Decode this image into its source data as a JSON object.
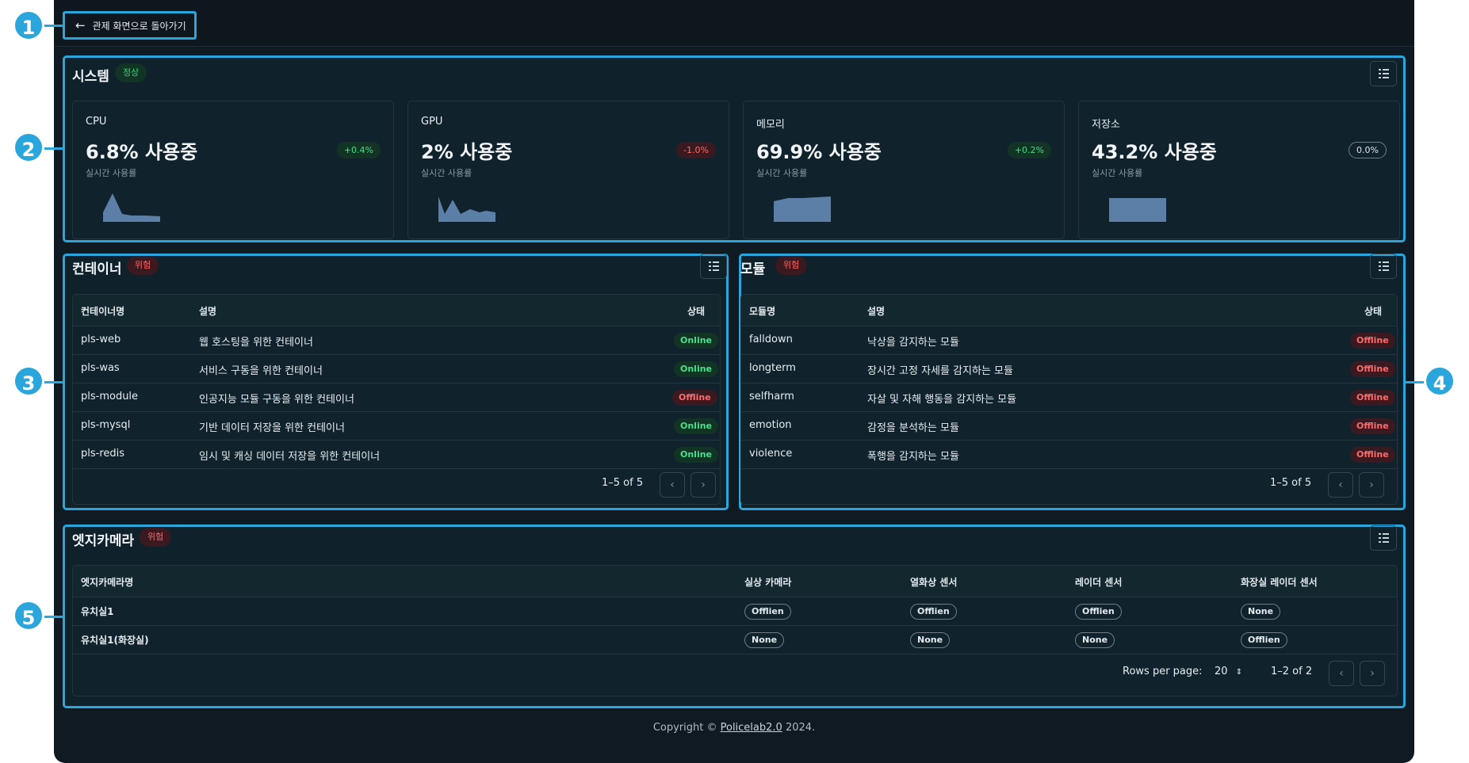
{
  "back_button": {
    "label": "관제 화면으로 돌아가기"
  },
  "system": {
    "title": "시스템",
    "status": "정상",
    "metrics": [
      {
        "name": "CPU",
        "value": "6.8% 사용중",
        "sub": "실시간 사용률",
        "delta": "+0.4%",
        "trend": "up"
      },
      {
        "name": "GPU",
        "value": "2% 사용중",
        "sub": "실시간 사용률",
        "delta": "-1.0%",
        "trend": "down"
      },
      {
        "name": "메모리",
        "value": "69.9% 사용중",
        "sub": "실시간 사용률",
        "delta": "+0.2%",
        "trend": "up"
      },
      {
        "name": "저장소",
        "value": "43.2% 사용중",
        "sub": "실시간 사용률",
        "delta": "0.0%",
        "trend": "flat"
      }
    ],
    "sparkline_color": "#5b7fa6"
  },
  "containers": {
    "title": "컨테이너",
    "status": "위험",
    "columns": [
      "컨테이너명",
      "설명",
      "상태"
    ],
    "rows": [
      {
        "name": "pls-web",
        "desc": "웹 호스팅을 위한 컨테이너",
        "state": "Online"
      },
      {
        "name": "pls-was",
        "desc": "서비스 구동을 위한 컨테이너",
        "state": "Online"
      },
      {
        "name": "pls-module",
        "desc": "인공지능 모듈 구동을 위한 컨테이너",
        "state": "Offline"
      },
      {
        "name": "pls-mysql",
        "desc": "기반 데이터 저장을 위한 컨테이너",
        "state": "Online"
      },
      {
        "name": "pls-redis",
        "desc": "임시 및 캐싱 데이터 저장을 위한 컨테이너",
        "state": "Online"
      }
    ],
    "range": "1–5 of 5"
  },
  "modules": {
    "title": "모듈",
    "status": "위험",
    "columns": [
      "모듈명",
      "설명",
      "상태"
    ],
    "rows": [
      {
        "name": "falldown",
        "desc": "낙상을 감지하는 모듈",
        "state": "Offline"
      },
      {
        "name": "longterm",
        "desc": "장시간 고정 자세를 감지하는 모듈",
        "state": "Offline"
      },
      {
        "name": "selfharm",
        "desc": "자살 및 자해 행동을 감지하는 모듈",
        "state": "Offline"
      },
      {
        "name": "emotion",
        "desc": "감정을 분석하는 모듈",
        "state": "Offline"
      },
      {
        "name": "violence",
        "desc": "폭행을 감지하는 모듈",
        "state": "Offline"
      }
    ],
    "range": "1–5 of 5"
  },
  "edge": {
    "title": "엣지카메라",
    "status": "위험",
    "columns": [
      "엣지카메라명",
      "실상 카메라",
      "열화상 센서",
      "레이더 센서",
      "화장실 레이더 센서"
    ],
    "rows": [
      {
        "name": "유치실1",
        "cells": [
          "Offlien",
          "Offlien",
          "Offlien",
          "None"
        ]
      },
      {
        "name": "유치실1(화장실)",
        "cells": [
          "None",
          "None",
          "None",
          "Offlien"
        ]
      }
    ],
    "rows_per_page_label": "Rows per page:",
    "rows_per_page": "20",
    "range": "1–2 of 2"
  },
  "footer": {
    "prefix": "Copyright ©",
    "link": "Policelab2.0",
    "suffix": "2024."
  },
  "markers": [
    "1",
    "2",
    "3",
    "4",
    "5"
  ],
  "colors": {
    "accent": "#2aa6dc",
    "ok": "#38d27a",
    "danger": "#ff6a6a",
    "background": "#101a22"
  }
}
